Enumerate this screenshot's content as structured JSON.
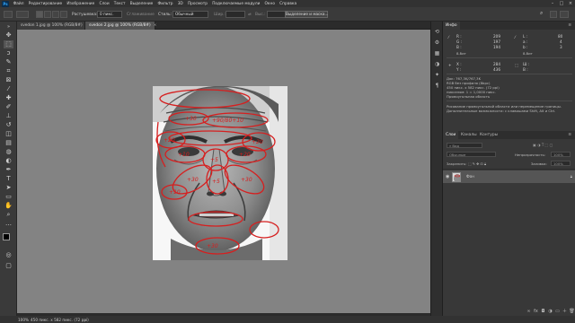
{
  "menubar": {
    "items": [
      "Файл",
      "Редактирование",
      "Изображение",
      "Слои",
      "Текст",
      "Выделение",
      "Фильтр",
      "3D",
      "Просмотр",
      "Подключаемые модули",
      "Окно",
      "Справка"
    ],
    "logo": "Ps"
  },
  "options": {
    "feather_label": "Растушевка:",
    "feather_value": "0 пикс.",
    "antialias_label": "Сглаживание",
    "style_label": "Стиль:",
    "style_value": "Обычный",
    "width_label": "Шир.:",
    "height_label": "Выс.:",
    "select_mask_button": "Выделение и маска..."
  },
  "tabs": [
    {
      "label": "svedon 1.jpg @ 100% (RGB/8#)",
      "close": "×"
    },
    {
      "label": "svedon 2.jpg @ 100% (RGB/8#)",
      "close": "×"
    }
  ],
  "active_tab": 1,
  "statusbar": {
    "zoom": "100%",
    "doc_info": "450 пикс. x 582 пикс. (72 ppi)",
    "arrow": "›"
  },
  "info_panel": {
    "tab": "Инфо",
    "r_label": "R :",
    "r_value": "209",
    "g_label": "G :",
    "g_value": "197",
    "b_label": "B :",
    "b_value": "194",
    "l_label": "L :",
    "l_value": "80",
    "a_label": "a :",
    "a_value": "4",
    "b2_label": "b :",
    "b2_value": "3",
    "bit_left": "8-бит",
    "bit_right": "8-бит",
    "x_label": "X :",
    "x_value": "284",
    "y_label": "Y :",
    "y_value": "436",
    "w_label": "Ш :",
    "h_label": "В :",
    "doc_line": "Док: 767,3K/767,3K",
    "no_profile": "RGB без профиля (8bpc)",
    "dimensions": "450 пикс. x 582 пикс. (72 ppi)",
    "pixel_ratio": "пикселям: 1 = 1,0000 пикс.",
    "tool_name": "Прямоугольная область",
    "hint_1": "Рисование прямоугольной области или перемещение границы.",
    "hint_2": "Дополнительные возможности: с клавишами Shift, Alt и Ctrl."
  },
  "layers_panel": {
    "tabs": [
      "Слои",
      "Каналы",
      "Контуры"
    ],
    "search_placeholder": "Вид",
    "blend_mode": "Обычные",
    "opacity_label": "Непрозрачность:",
    "opacity_value": "100%",
    "lock_label": "Закрепить:",
    "fill_label": "Заливка:",
    "fill_value": "100%",
    "layer_name": "Фон"
  }
}
